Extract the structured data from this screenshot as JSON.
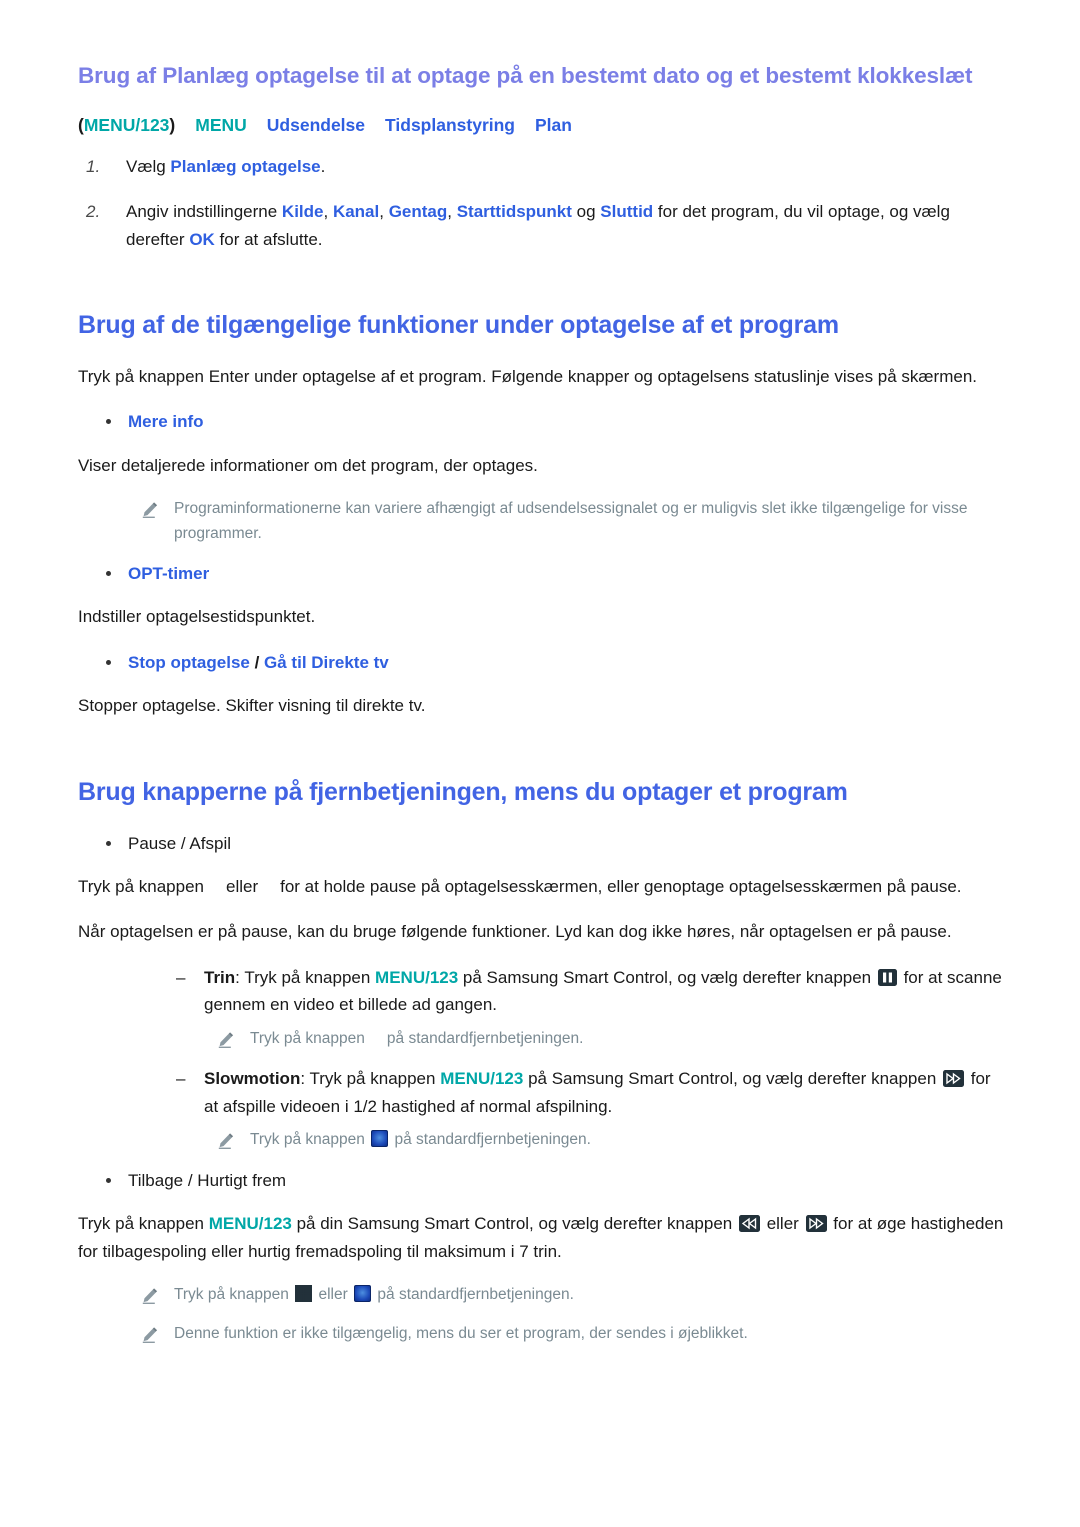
{
  "document": {
    "language": "da",
    "colors": {
      "heading_violet": "#7b7fe6",
      "heading_blue": "#4264e4",
      "link_blue": "#2f5fe0",
      "menu_teal": "#00a7a7",
      "note_gray": "#7a8a92",
      "body_text": "#1a1a1a",
      "key_icon_bg": "#22313a"
    }
  },
  "section1": {
    "heading": "Brug af Planlæg optagelse til at optage på en bestemt dato og et bestemt klokkeslæt",
    "breadcrumb": {
      "open_paren": "(",
      "menu_key": "MENU/123",
      "close_paren": ")",
      "items": [
        "MENU",
        "Udsendelse",
        "Tidsplanstyring",
        "Plan"
      ]
    },
    "steps": [
      {
        "number": "1.",
        "pre": "Vælg ",
        "emphasis": "Planlæg optagelse",
        "post": "."
      },
      {
        "number": "2.",
        "pre": "Angiv indstillingerne ",
        "settings": [
          "Kilde",
          "Kanal",
          "Gentag",
          "Starttidspunkt"
        ],
        "mid": " og ",
        "last_setting": "Sluttid",
        "post": " for det program, du vil optage, og vælg derefter ",
        "ok": "OK",
        "tail": " for at afslutte."
      }
    ]
  },
  "section2": {
    "heading": "Brug af de tilgængelige funktioner under optagelse af et program",
    "intro": "Tryk på knappen Enter under optagelse af et program. Følgende knapper og optagelsens statuslinje vises på skærmen.",
    "items": [
      {
        "label": "Mere info",
        "description": "Viser detaljerede informationer om det program, der optages.",
        "note": "Programinformationerne kan variere afhængigt af udsendelsessignalet og er muligvis slet ikke tilgængelige for visse programmer."
      },
      {
        "label": "OPT-timer",
        "description": "Indstiller optagelsestidspunktet."
      },
      {
        "label_a": "Stop optagelse",
        "separator": " / ",
        "label_b": "Gå til Direkte tv",
        "description": "Stopper optagelse. Skifter visning til direkte tv."
      }
    ]
  },
  "section3": {
    "heading": "Brug knapperne på fjernbetjeningen, mens du optager et program",
    "pause_play": {
      "bullet": "Pause / Afspil",
      "para1_a": "Tryk på knappen",
      "para1_b": "eller",
      "para1_c": "for at holde pause på optagelsesskærmen, eller genoptage optagelsesskærmen på pause.",
      "para2": "Når optagelsen er på pause, kan du bruge følgende funktioner. Lyd kan dog ikke høres, når optagelsen er på pause.",
      "sub": [
        {
          "term": "Trin",
          "colon": ": ",
          "pre": "Tryk på knappen ",
          "menu_key": "MENU/123",
          "mid": " på Samsung Smart Control, og vælg derefter knappen ",
          "icon": "pause-icon",
          "post": " for at scanne gennem en video et billede ad gangen.",
          "note_pre": "Tryk på knappen",
          "note_icon": "",
          "note_post": "på standardfjernbetjeningen."
        },
        {
          "term": "Slowmotion",
          "colon": ": ",
          "pre": "Tryk på knappen ",
          "menu_key": "MENU/123",
          "mid": " på Samsung Smart Control, og vælg derefter knappen ",
          "icon": "fast-forward-icon",
          "post": " for at afspille videoen i 1/2 hastighed af normal afspilning.",
          "note_pre": "Tryk på knappen ",
          "note_icon": "blue-key-icon",
          "note_post": " på standardfjernbetjeningen."
        }
      ]
    },
    "rewind_forward": {
      "bullet": "Tilbage / Hurtigt frem",
      "para_pre": "Tryk på knappen ",
      "menu_key": "MENU/123",
      "para_mid": " på din Samsung Smart Control, og vælg derefter knappen ",
      "icon_a": "rewind-icon",
      "para_eller": " eller ",
      "icon_b": "fast-forward-icon",
      "para_post": " for at øge hastigheden for tilbagespoling eller hurtig fremadspoling til maksimum i 7 trin.",
      "notes": [
        {
          "pre": "Tryk på knappen ",
          "icon_a": "grid-key-icon",
          "mid": " eller ",
          "icon_b": "blue-key-icon",
          "post": " på standardfjernbetjeningen."
        },
        {
          "text": "Denne funktion er ikke tilgængelig, mens du ser et program, der sendes i øjeblikket."
        }
      ]
    }
  }
}
